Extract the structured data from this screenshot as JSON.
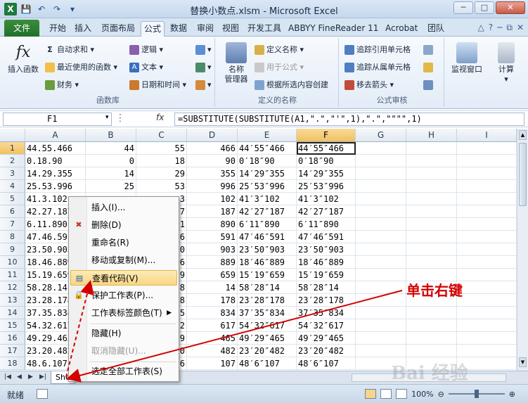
{
  "window": {
    "title": "替换小数点.xlsm - Microsoft Excel",
    "minimize": "─",
    "maximize": "□",
    "close": "✕"
  },
  "qat": {
    "save_icon": "💾",
    "undo_icon": "↶",
    "redo_icon": "↷",
    "customize_icon": "▾"
  },
  "tabs": {
    "file": "文件",
    "items": [
      "开始",
      "插入",
      "页面布局",
      "公式",
      "数据",
      "审阅",
      "视图",
      "开发工具",
      "ABBYY FineReader 11",
      "Acrobat",
      "团队"
    ],
    "active": "公式"
  },
  "ribbon": {
    "insert_function": "插入函数",
    "fx": "fx",
    "autosum": "自动求和",
    "recent": "最近使用的函数",
    "financial": "财务",
    "logical": "逻辑",
    "text": "文本",
    "datetime": "日期和时间",
    "group_library": "函数库",
    "name_manager": "名称\n管理器",
    "define_name": "定义名称",
    "use_in_formula": "用于公式",
    "create_from_selection": "根据所选内容创建",
    "group_names": "定义的名称",
    "trace_precedents": "追踪引用单元格",
    "trace_dependents": "追踪从属单元格",
    "remove_arrows": "移去箭头",
    "group_audit": "公式审核",
    "watch_window": "监视窗口",
    "calculate": "计算"
  },
  "formula_bar": {
    "name_box": "F1",
    "fx": "fx",
    "formula": "=SUBSTITUTE(SUBSTITUTE(A1,\".\",\"'\",1),\".\",\"\"\"\",1)"
  },
  "grid": {
    "columns": [
      "A",
      "B",
      "C",
      "D",
      "E",
      "F",
      "G",
      "H",
      "I"
    ],
    "selected_column": "F",
    "selected_row": 1,
    "rows": [
      {
        "n": "1",
        "a": "44.55.466",
        "b": "44",
        "c": "55",
        "d": "466",
        "e": "44′55″466",
        "f": "44′55″466"
      },
      {
        "n": "2",
        "a": "0.18.90",
        "b": "0",
        "c": "18",
        "d": "90",
        "e": "0′18″90",
        "f": "0′18″90"
      },
      {
        "n": "3",
        "a": "14.29.355",
        "b": "14",
        "c": "29",
        "d": "355",
        "e": "14′29″355",
        "f": "14′29″355"
      },
      {
        "n": "4",
        "a": "25.53.996",
        "b": "25",
        "c": "53",
        "d": "996",
        "e": "25′53″996",
        "f": "25′53″996"
      },
      {
        "n": "5",
        "a": "41.3.102",
        "b": "",
        "c": "3",
        "d": "102",
        "e": "41′3″102",
        "f": "41′3″102"
      },
      {
        "n": "6",
        "a": "42.27.187",
        "b": "",
        "c": "7",
        "d": "187",
        "e": "42′27″187",
        "f": "42′27″187"
      },
      {
        "n": "7",
        "a": "6.11.890",
        "b": "",
        "c": "1",
        "d": "890",
        "e": "6′11″890",
        "f": "6′11″890"
      },
      {
        "n": "8",
        "a": "47.46.591",
        "b": "",
        "c": "6",
        "d": "591",
        "e": "47′46″591",
        "f": "47′46″591"
      },
      {
        "n": "9",
        "a": "23.50.903",
        "b": "",
        "c": "0",
        "d": "903",
        "e": "23′50″903",
        "f": "23′50″903"
      },
      {
        "n": "10",
        "a": "18.46.889",
        "b": "",
        "c": "6",
        "d": "889",
        "e": "18′46″889",
        "f": "18′46″889"
      },
      {
        "n": "11",
        "a": "15.19.659",
        "b": "",
        "c": "9",
        "d": "659",
        "e": "15′19″659",
        "f": "15′19″659"
      },
      {
        "n": "12",
        "a": "58.28.14",
        "b": "",
        "c": "8",
        "d": "14",
        "e": "58′28″14",
        "f": "58′28″14"
      },
      {
        "n": "13",
        "a": "23.28.178",
        "b": "",
        "c": "8",
        "d": "178",
        "e": "23′28″178",
        "f": "23′28″178"
      },
      {
        "n": "14",
        "a": "37.35.834",
        "b": "",
        "c": "5",
        "d": "834",
        "e": "37′35″834",
        "f": "37′35″834"
      },
      {
        "n": "15",
        "a": "54.32.617",
        "b": "",
        "c": "2",
        "d": "617",
        "e": "54′32″617",
        "f": "54′32″617"
      },
      {
        "n": "16",
        "a": "49.29.465",
        "b": "",
        "c": "9",
        "d": "465",
        "e": "49′29″465",
        "f": "49′29″465"
      },
      {
        "n": "17",
        "a": "23.20.482",
        "b": "",
        "c": "0",
        "d": "482",
        "e": "23′20″482",
        "f": "23′20″482"
      },
      {
        "n": "18",
        "a": "48.6.107",
        "b": "",
        "c": "6",
        "d": "107",
        "e": "48′6″107",
        "f": "48′6″107"
      }
    ]
  },
  "context_menu": {
    "insert": "插入(I)...",
    "delete": "删除(D)",
    "rename": "重命名(R)",
    "move_copy": "移动或复制(M)...",
    "view_code": "查看代码(V)",
    "protect": "保护工作表(P)...",
    "tab_color": "工作表标签颜色(T)",
    "hide": "隐藏(H)",
    "unhide": "取消隐藏(U)...",
    "select_all": "选定全部工作表(S)"
  },
  "sheet_tabs": {
    "first_tab": "She"
  },
  "status": {
    "ready": "就绪",
    "zoom": "100%"
  },
  "annotation": {
    "text": "单击右键",
    "color": "#d40000"
  },
  "watermark": "Bai 经验"
}
